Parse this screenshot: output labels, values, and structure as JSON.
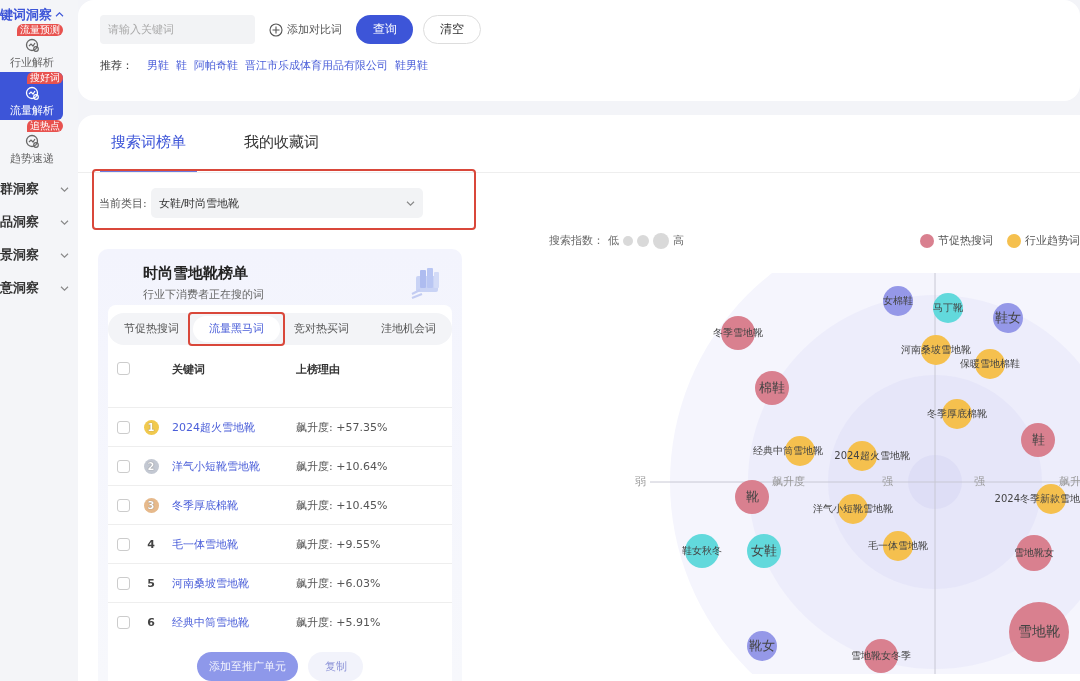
{
  "sidebar": {
    "header": {
      "label": "键词洞察",
      "expanded": true
    },
    "items": [
      {
        "label": "行业解析",
        "badge": "流量预测",
        "selected": false
      },
      {
        "label": "流量解析",
        "badge": "搜好词",
        "selected": true
      },
      {
        "label": "趋势速递",
        "badge": "追热点",
        "selected": false
      }
    ],
    "groups": [
      {
        "label": "群洞察",
        "expanded": false
      },
      {
        "label": "品洞察",
        "expanded": false
      },
      {
        "label": "景洞察",
        "expanded": false
      },
      {
        "label": "意洞察",
        "expanded": false
      }
    ]
  },
  "search": {
    "placeholder": "请输入关键词",
    "add_compare": "添加对比词",
    "buttons": [
      {
        "label": "查询",
        "kind": "primary"
      },
      {
        "label": "清空",
        "kind": "outline"
      }
    ],
    "recommend_label": "推荐：",
    "recommendations": [
      "男鞋",
      "鞋",
      "阿帕奇鞋",
      "晋江市乐成体育用品有限公司",
      "鞋男鞋"
    ]
  },
  "tabs": [
    {
      "label": "搜索词榜单",
      "selected": true
    },
    {
      "label": "我的收藏词",
      "selected": false
    }
  ],
  "category": {
    "label": "当前类目:",
    "value": "女鞋/时尚雪地靴",
    "highlighted": true
  },
  "ranking": {
    "title": "时尚雪地靴榜单",
    "subtitle": "行业下消费者正在搜的词",
    "tabs": [
      {
        "label": "节促热搜词",
        "selected": false
      },
      {
        "label": "流量黑马词",
        "selected": true
      },
      {
        "label": "竞对热买词",
        "selected": false
      },
      {
        "label": "洼地机会词",
        "selected": false
      }
    ],
    "columns": [
      "关键词",
      "上榜理由"
    ],
    "all_checked": false,
    "rows": [
      {
        "rank": "1",
        "kind": "medal",
        "color": "#f1c94e",
        "keyword": "2024超火雪地靴",
        "reason": "飙升度: +57.35%",
        "checked": false
      },
      {
        "rank": "2",
        "kind": "medal",
        "color": "#c3c8d2",
        "keyword": "洋气小短靴雪地靴",
        "reason": "飙升度: +10.64%",
        "checked": false
      },
      {
        "rank": "3",
        "kind": "medal",
        "color": "#e6b98b",
        "keyword": "冬季厚底棉靴",
        "reason": "飙升度: +10.45%",
        "checked": false
      },
      {
        "rank": "4",
        "kind": "number",
        "keyword": "毛一体雪地靴",
        "reason": "飙升度: +9.55%",
        "checked": false
      },
      {
        "rank": "5",
        "kind": "number",
        "keyword": "河南桑坡雪地靴",
        "reason": "飙升度: +6.03%",
        "checked": false
      },
      {
        "rank": "6",
        "kind": "number",
        "keyword": "经典中筒雪地靴",
        "reason": "飙升度: +5.91%",
        "checked": false
      }
    ],
    "buttons": [
      {
        "label": "添加至推广单元",
        "kind": "primary",
        "disabled": true
      },
      {
        "label": "复制",
        "kind": "plain",
        "disabled": true
      }
    ]
  },
  "bubble_chart": {
    "size_legend": {
      "label": "搜索指数：",
      "low": "低",
      "high": "高"
    },
    "legend": [
      {
        "label": "节促热搜词",
        "color": "#d9808f"
      },
      {
        "label": "行业趋势词",
        "color": "#f5c04e"
      }
    ],
    "axis_labels": [
      "弱",
      "飙升度",
      "强",
      "强",
      "飙升"
    ],
    "bubbles": [
      {
        "label": "女棉鞋",
        "color": "#9598e8"
      },
      {
        "label": "马丁靴",
        "color": "#62d9dc"
      },
      {
        "label": "鞋女",
        "color": "#9598e8"
      },
      {
        "label": "冬季雪地靴",
        "color": "#d9808f"
      },
      {
        "label": "河南桑坡雪地靴",
        "color": "#f5c04e"
      },
      {
        "label": "保暖雪地棉鞋",
        "color": "#f5c04e"
      },
      {
        "label": "棉鞋",
        "color": "#d9808f"
      },
      {
        "label": "冬季厚底棉靴",
        "color": "#f5c04e"
      },
      {
        "label": "鞋",
        "color": "#d9808f"
      },
      {
        "label": "经典中筒雪地靴",
        "color": "#f5c04e"
      },
      {
        "label": "2024超火雪地靴",
        "color": "#f5c04e"
      },
      {
        "label": "靴",
        "color": "#d9808f"
      },
      {
        "label": "洋气小短靴雪地靴",
        "color": "#f5c04e"
      },
      {
        "label": "2024冬季新款雪地",
        "color": "#f5c04e"
      },
      {
        "label": "毛一体雪地靴",
        "color": "#f5c04e"
      },
      {
        "label": "鞋女秋冬",
        "color": "#62d9dc"
      },
      {
        "label": "女鞋",
        "color": "#62d9dc"
      },
      {
        "label": "雪地靴女",
        "color": "#d9808f"
      },
      {
        "label": "雪地靴",
        "color": "#d9808f"
      },
      {
        "label": "靴女",
        "color": "#9598e8"
      },
      {
        "label": "雪地靴女冬季",
        "color": "#d9808f"
      }
    ]
  }
}
